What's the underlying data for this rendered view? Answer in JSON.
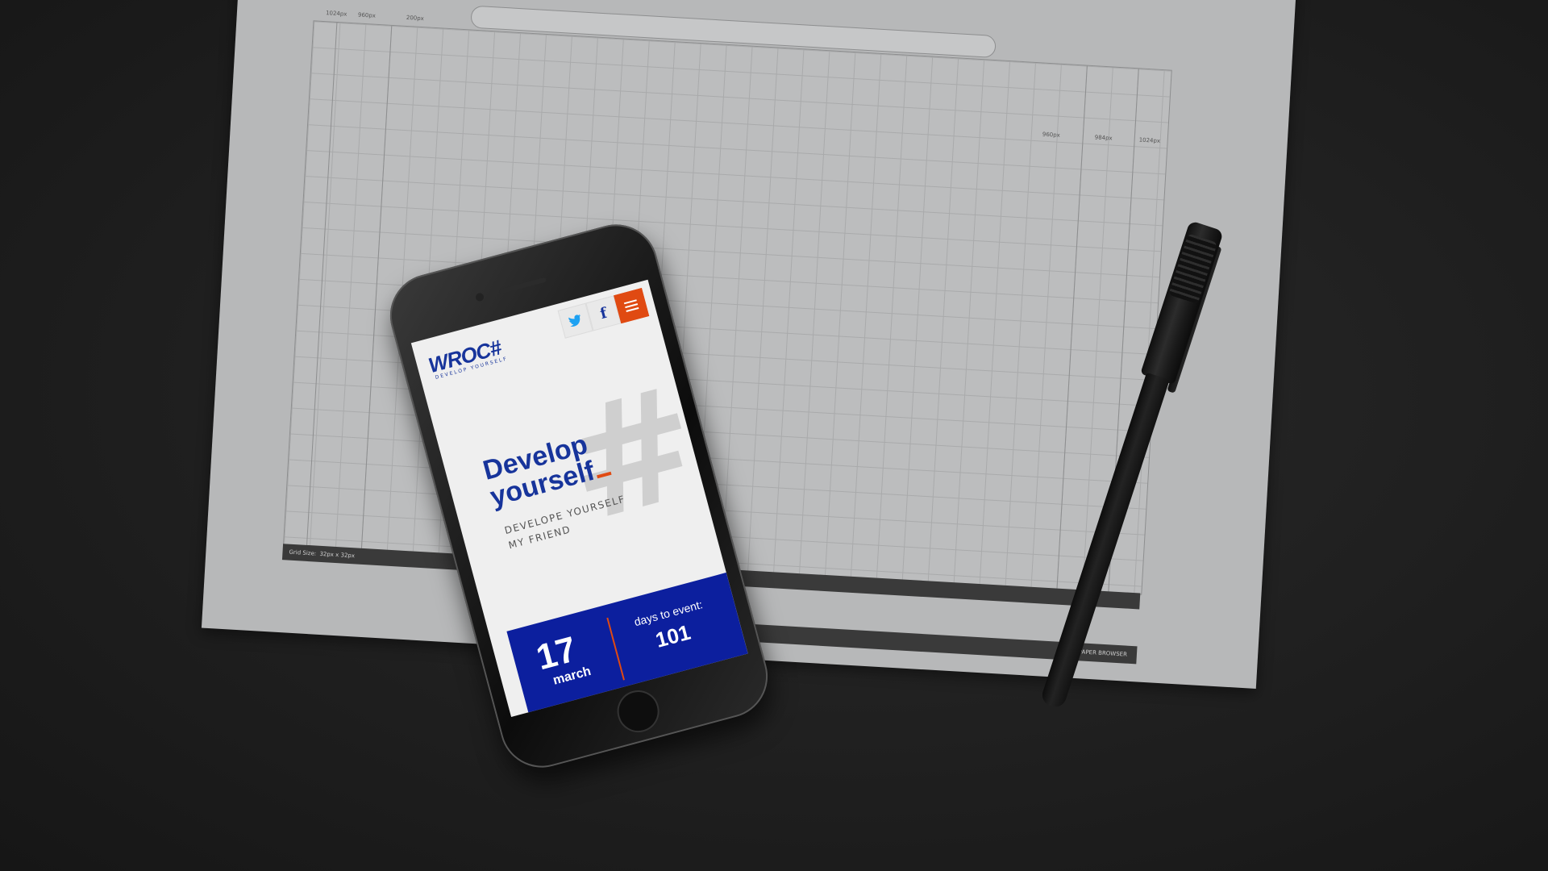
{
  "paper": {
    "ruler_top": [
      "1024px",
      "960px",
      "200px"
    ],
    "ruler_right": [
      "960px",
      "984px",
      "1024px"
    ],
    "grid_label": "Grid Size:",
    "grid_value": "32px x 32px",
    "footer_label": "PAPER BROWSER"
  },
  "phone_screen": {
    "logo": "WROC#",
    "logo_tagline": "DEVELOP YOURSELF",
    "hero_title_line1": "Develop",
    "hero_title_line2": "yourself",
    "hero_subtitle_line1": "DEVELOPE YOURSELF",
    "hero_subtitle_line2": "MY FRIEND",
    "hero_decoration": "#",
    "event_day": "17",
    "event_month": "march",
    "days_label": "days to event:",
    "days_count": "101"
  },
  "colors": {
    "brand_blue": "#17349b",
    "event_blue": "#0c1f9e",
    "accent_orange": "#e04a12"
  },
  "icons": [
    "twitter-icon",
    "facebook-icon",
    "menu-icon"
  ]
}
